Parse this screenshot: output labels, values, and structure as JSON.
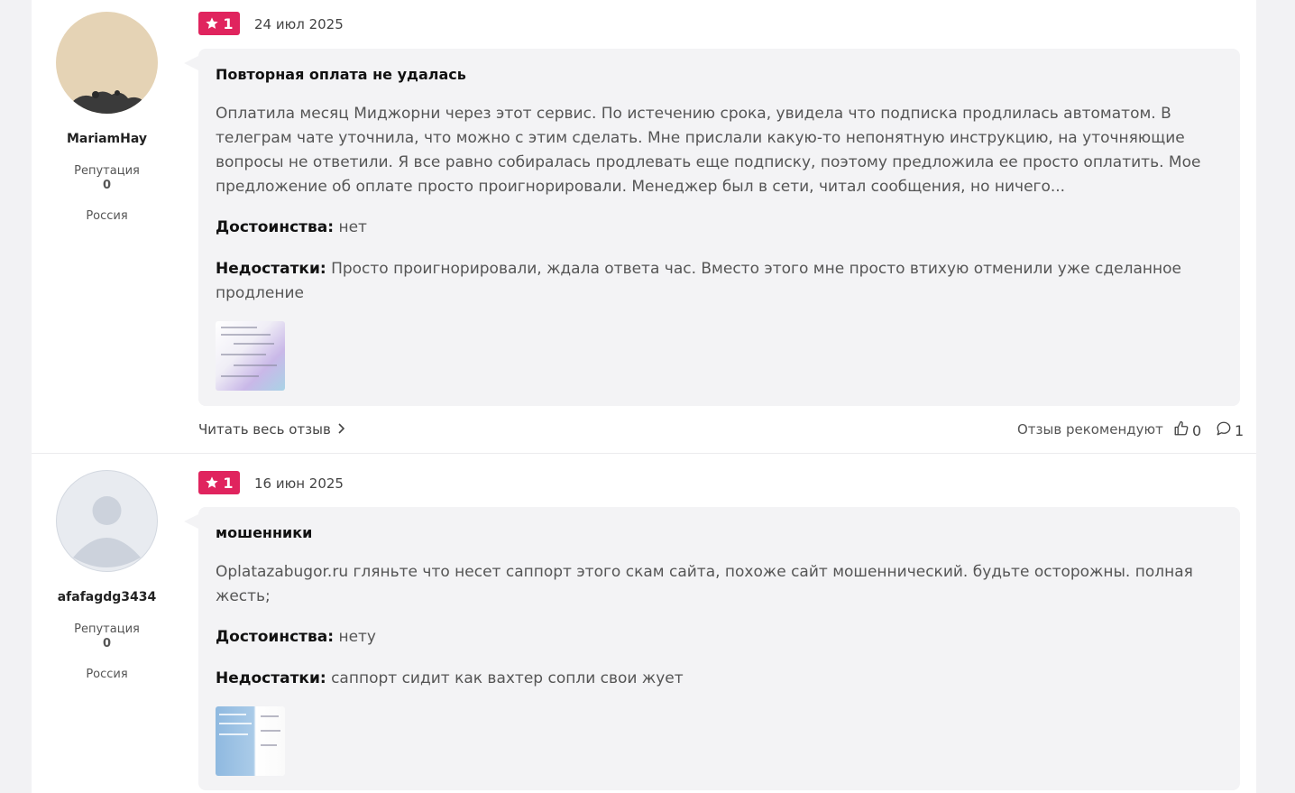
{
  "reviews": [
    {
      "author": {
        "name": "MariamHay",
        "reputation_label": "Репутация",
        "reputation_value": "0",
        "country": "Россия",
        "avatar": "user-photo"
      },
      "rating": "1",
      "date": "24 июл 2025",
      "title": "Повторная оплата не удалась",
      "body": "Оплатила месяц Миджорни через этот сервис. По истечению срока, увидела что подписка продлилась автоматом. В телеграм чате уточнила, что можно с этим сделать. Мне прислали какую-то непонятную инструкцию, на уточняющие вопросы не ответили. Я все равно собиралась продлевать еще подписку, поэтому предложила ее просто оплатить. Мое предложение об оплате просто проигнорировали. Менеджер был в сети, читал сообщения, но ничего...",
      "pros_label": "Достоинства:",
      "pros": "нет",
      "cons_label": "Недостатки:",
      "cons": "Просто проигнорировали, ждала ответа час. Вместо этого мне просто втихую отменили уже сделанное продление",
      "read_more": "Читать весь отзыв",
      "recommend_label": "Отзыв рекомендуют",
      "likes": "0",
      "comments": "1"
    },
    {
      "author": {
        "name": "afafagdg3434",
        "reputation_label": "Репутация",
        "reputation_value": "0",
        "country": "Россия",
        "avatar": "default-avatar"
      },
      "rating": "1",
      "date": "16 июн 2025",
      "title": "мошенники",
      "body": "Oplatazabugor.ru гляньте что несет саппорт этого скам сайта, похоже сайт мошеннический. будьте осторожны. полная жесть;",
      "pros_label": "Достоинства:",
      "pros": "нету",
      "cons_label": "Недостатки:",
      "cons": "саппорт сидит как вахтер сопли свои жует"
    }
  ],
  "colors": {
    "badge": "#e0245e",
    "card_bg": "#f3f3f5",
    "page_bg": "#f2f2f4"
  },
  "icons": {
    "rating": "star-icon",
    "read_more": "chevron-right-icon",
    "likes": "thumbs-up-icon",
    "comments": "comment-icon"
  }
}
